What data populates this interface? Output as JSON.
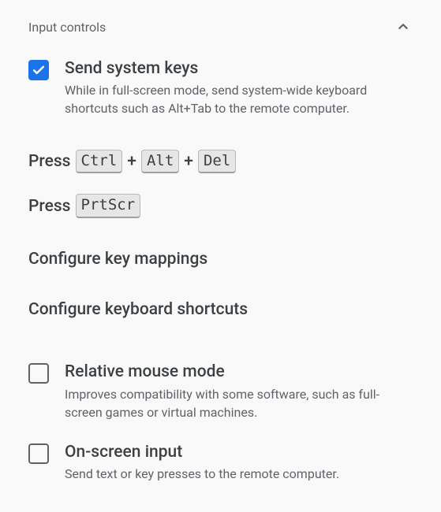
{
  "section": {
    "title": "Input controls"
  },
  "options": {
    "send_system_keys": {
      "title": "Send system keys",
      "desc": "While in full-screen mode, send system-wide keyboard shortcuts such as Alt+Tab to the remote computer.",
      "checked": true
    },
    "relative_mouse": {
      "title": "Relative mouse mode",
      "desc": "Improves compatibility with some software, such as full-screen games or virtual machines.",
      "checked": false
    },
    "onscreen_input": {
      "title": "On-screen input",
      "desc": "Send text or key presses to the remote computer.",
      "checked": false
    }
  },
  "press": {
    "label": "Press",
    "ctrl_alt_del": {
      "keys": [
        "Ctrl",
        "Alt",
        "Del"
      ]
    },
    "prtscr": {
      "keys": [
        "PrtScr"
      ]
    }
  },
  "links": {
    "key_mappings": "Configure key mappings",
    "keyboard_shortcuts": "Configure keyboard shortcuts"
  }
}
